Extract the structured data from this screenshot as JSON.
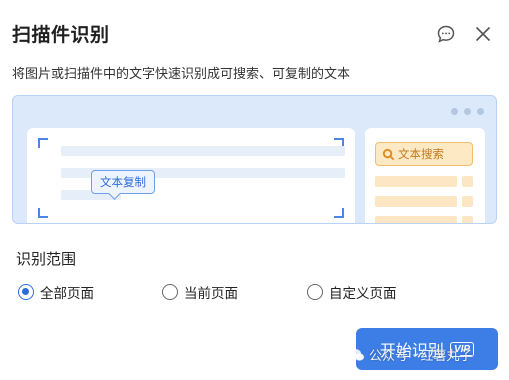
{
  "dialog": {
    "title": "扫描件识别",
    "subtitle": "将图片或扫描件中的文字快速识别成可搜索、可复制的文本",
    "header_icons": [
      "feedback-icon",
      "close-icon"
    ]
  },
  "illustration": {
    "copy_label": "文本复制",
    "search_label": "文本搜索",
    "accent_blue": "#3d7de6",
    "accent_orange": "#f3c06a"
  },
  "range": {
    "label": "识别范围",
    "options": [
      {
        "label": "全部页面",
        "checked": true
      },
      {
        "label": "当前页面",
        "checked": false
      },
      {
        "label": "自定义页面",
        "checked": false
      }
    ]
  },
  "actions": {
    "start_label": "开始识别",
    "vip_badge": "VIP"
  },
  "watermark": {
    "text": "公众号 · 红薯丸子"
  }
}
